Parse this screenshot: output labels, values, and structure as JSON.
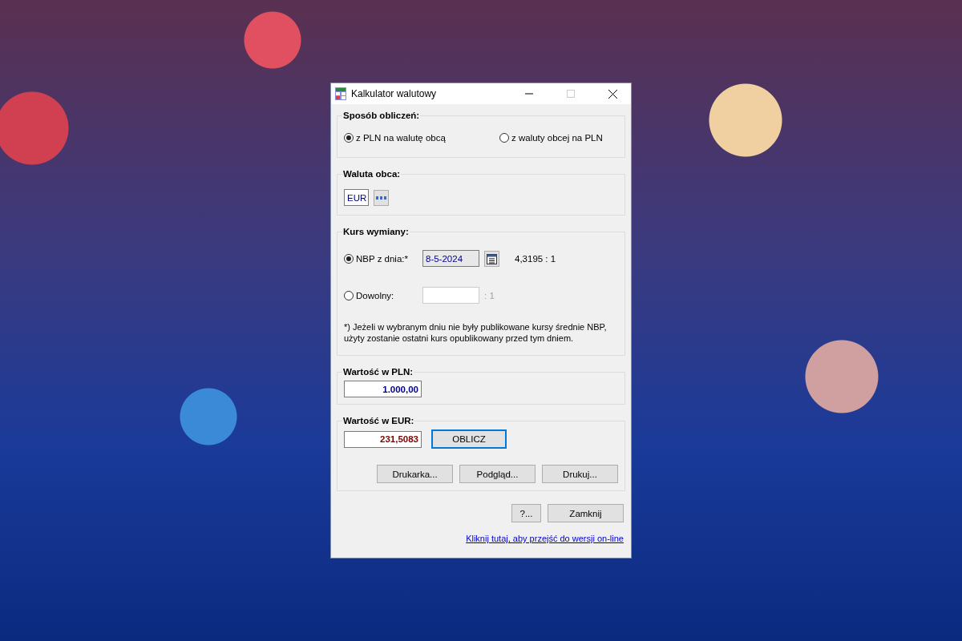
{
  "window": {
    "title": "Kalkulator walutowy"
  },
  "calculation_mode": {
    "legend": "Sposób obliczeń:",
    "options": [
      {
        "label": "z PLN na walutę obcą",
        "selected": true
      },
      {
        "label": "z waluty obcej na PLN",
        "selected": false
      }
    ]
  },
  "foreign_currency": {
    "legend": "Waluta obca:",
    "value": "EUR"
  },
  "exchange_rate": {
    "legend": "Kurs wymiany:",
    "nbp": {
      "label": "NBP z dnia:*",
      "selected": true,
      "date": "8-5-2024",
      "rate": "4,3195 : 1"
    },
    "custom": {
      "label": "Dowolny:",
      "selected": false,
      "disabled": true,
      "ratio": ": 1"
    },
    "note": "*) Jeżeli w wybranym dniu nie były publikowane kursy średnie NBP, użyty zostanie ostatni kurs opublikowany przed tym dniem."
  },
  "value_pln": {
    "legend": "Wartość w PLN:",
    "value": "1.000,00"
  },
  "value_eur": {
    "legend": "Wartość w EUR:",
    "value": "231,5083",
    "compute_button": "OBLICZ",
    "buttons": [
      "Drukarka...",
      "Podgląd...",
      "Drukuj..."
    ]
  },
  "footer_buttons": [
    "?...",
    "Zamknij"
  ],
  "link": "Kliknij tutaj, aby przejść do wersji on-line"
}
